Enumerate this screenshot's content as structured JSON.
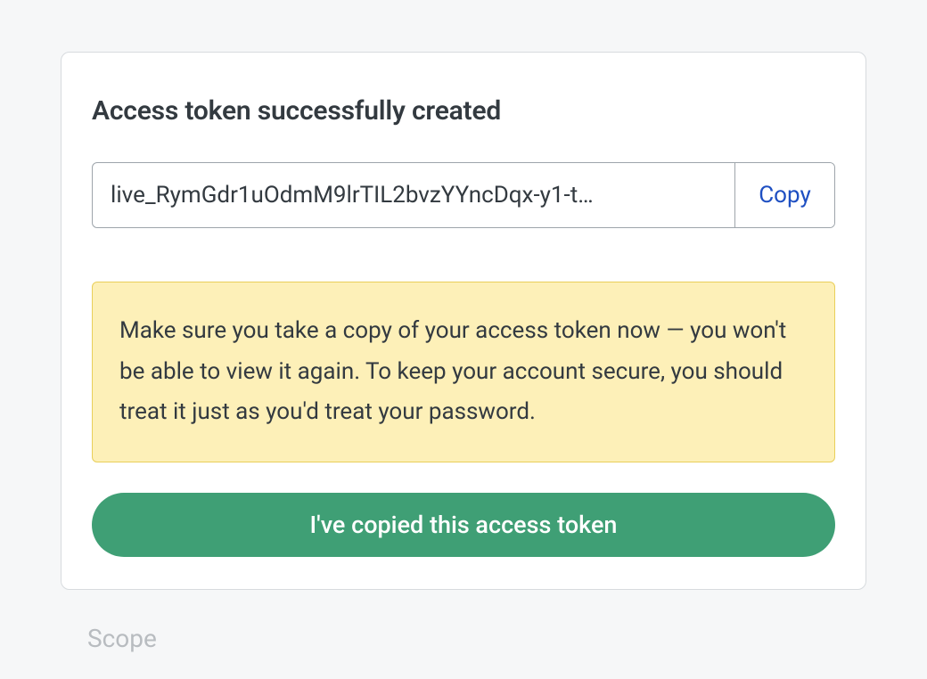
{
  "backdrop": {
    "scope_label": "Scope"
  },
  "modal": {
    "title": "Access token successfully created",
    "token_value": "live_RymGdr1uOdmM9lrTIL2bvzYYncDqx-y1-t…",
    "copy_label": "Copy",
    "warning_message": "Make sure you take a copy of your access token now — you won't be able to view it again. To keep your account secure, you should treat it just as you'd treat your password.",
    "confirm_label": "I've copied this access token"
  }
}
